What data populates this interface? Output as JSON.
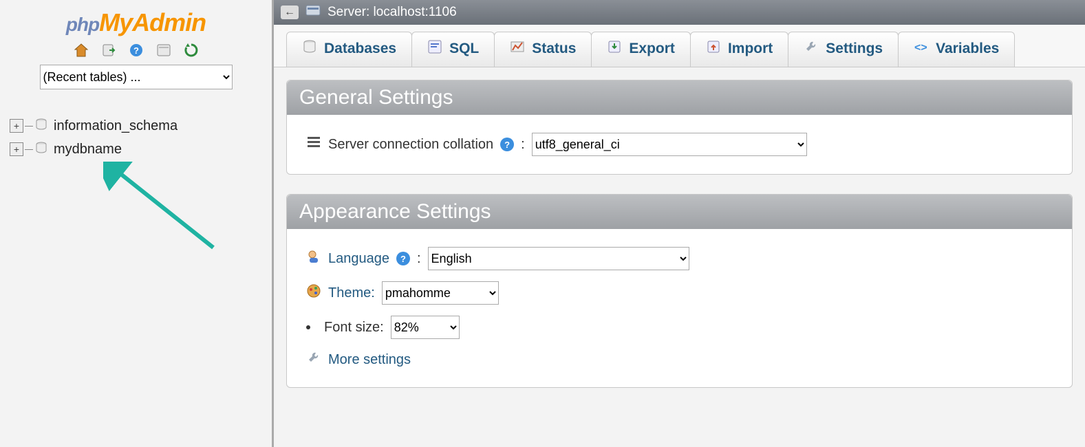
{
  "logo": {
    "part1": "php",
    "part2": "My",
    "part3": "Admin"
  },
  "sidebar": {
    "recent_placeholder": "(Recent tables) ...",
    "databases": [
      {
        "label": "information_schema"
      },
      {
        "label": "mydbname"
      }
    ]
  },
  "topbar": {
    "server_label": "Server: localhost:1106"
  },
  "tabs": [
    {
      "label": "Databases"
    },
    {
      "label": "SQL"
    },
    {
      "label": "Status"
    },
    {
      "label": "Export"
    },
    {
      "label": "Import"
    },
    {
      "label": "Settings"
    },
    {
      "label": "Variables"
    }
  ],
  "general": {
    "heading": "General Settings",
    "collation_label": "Server connection collation",
    "collation_value": "utf8_general_ci"
  },
  "appearance": {
    "heading": "Appearance Settings",
    "language_label": "Language",
    "language_value": "English",
    "theme_label": "Theme:",
    "theme_value": "pmahomme",
    "fontsize_label": "Font size:",
    "fontsize_value": "82%",
    "more_settings": "More settings"
  }
}
